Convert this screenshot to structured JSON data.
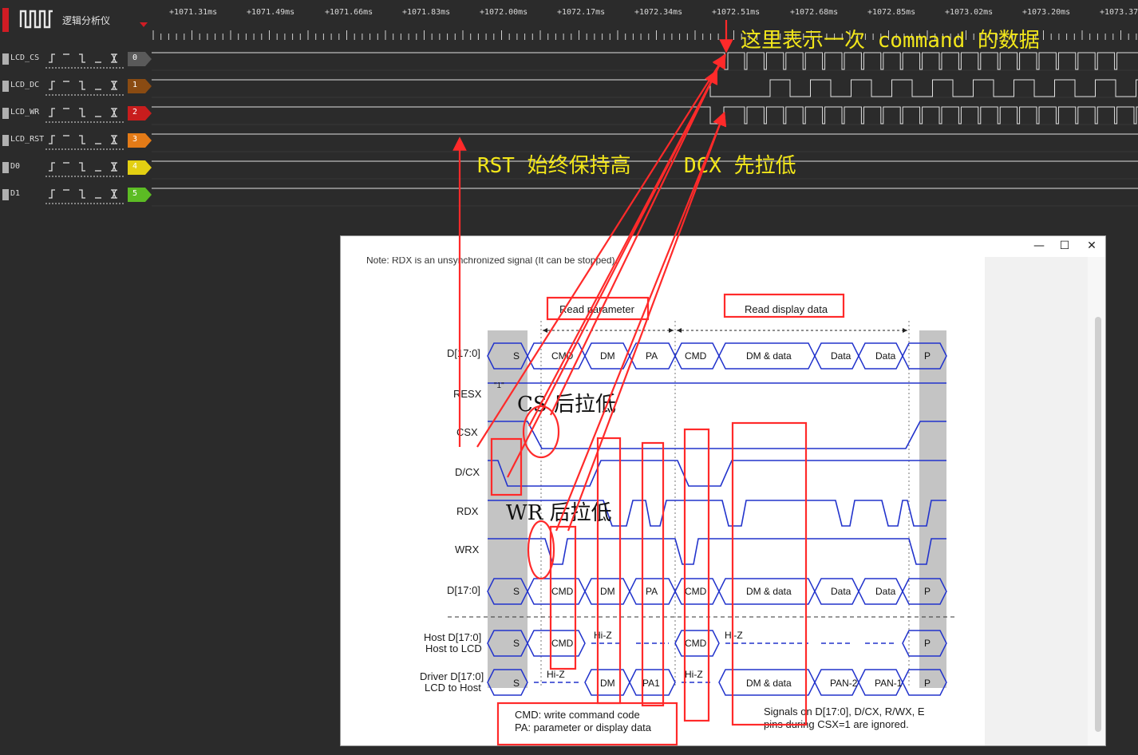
{
  "app": {
    "title": "逻辑分析仪",
    "icon": "logic-wave-icon",
    "accent": "#d01c24"
  },
  "ruler": {
    "ticks": [
      "+1071.31ms",
      "+1071.49ms",
      "+1071.66ms",
      "+1071.83ms",
      "+1072.00ms",
      "+1072.17ms",
      "+1072.34ms",
      "+1072.51ms",
      "+1072.68ms",
      "+1072.85ms",
      "+1073.02ms",
      "+1073.20ms",
      "+1073.37"
    ]
  },
  "channels": [
    {
      "name": "LCD_CS",
      "index": "0",
      "color": "#5a5a5a"
    },
    {
      "name": "LCD_DC",
      "index": "1",
      "color": "#8a4b12"
    },
    {
      "name": "LCD_WR",
      "index": "2",
      "color": "#c81d1d"
    },
    {
      "name": "LCD_RST",
      "index": "3",
      "color": "#e47b17"
    },
    {
      "name": "D0",
      "index": "4",
      "color": "#e3cf12"
    },
    {
      "name": "D1",
      "index": "5",
      "color": "#5cbc24"
    }
  ],
  "annotations": {
    "command": "这里表示一次 command 的数据",
    "rst": "RST 始终保持高",
    "dcx": "DCX 先拉低",
    "cs": "CS 后拉低",
    "wr": "WR 后拉低"
  },
  "window": {
    "minimize": "—",
    "maximize": "☐",
    "close": "✕"
  },
  "doc": {
    "note": "Note: RDX is an unsynchronized signal (It can be stopped).",
    "read_parameter": "Read parameter",
    "read_display_data": "Read display data",
    "signals": [
      "D[17:0]",
      "RESX",
      "CSX",
      "D/CX",
      "RDX",
      "WRX",
      "D[17:0]"
    ],
    "resx_value": "\"1\"",
    "bus_top": [
      "S",
      "CMD",
      "DM",
      "PA",
      "CMD",
      "DM & data",
      "Data",
      "Data",
      "P"
    ],
    "bus_bottom": [
      "S",
      "CMD",
      "DM",
      "PA",
      "CMD",
      "DM & data",
      "Data",
      "Data",
      "P"
    ],
    "host_label_1": "Host D[17:0]",
    "host_label_2": "Host to LCD",
    "host_bus": [
      "S",
      "CMD",
      "Hi-Z",
      "CMD",
      "Hi-Z",
      "P"
    ],
    "driver_label_1": "Driver D[17:0]",
    "driver_label_2": "LCD to Host",
    "driver_bus": [
      "S",
      "Hi-Z",
      "DM",
      "PA1",
      "Hi-Z",
      "DM & data",
      "PAN-2",
      "PAN-1",
      "P"
    ],
    "legend_1": "CMD: write command code",
    "legend_2": "PA: parameter or display data",
    "ignored_1": "Signals on D[17:0], D/CX, R/WX, E",
    "ignored_2": "pins during CSX=1 are ignored."
  }
}
